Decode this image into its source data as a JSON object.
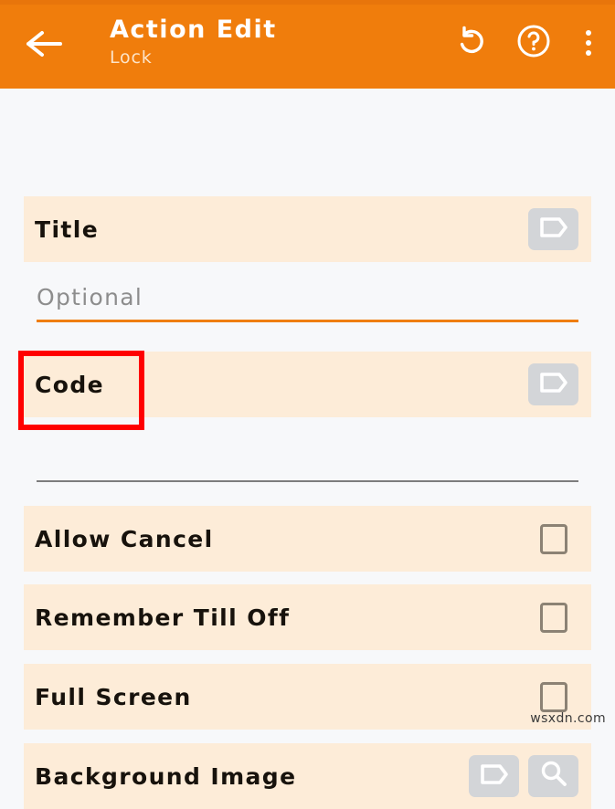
{
  "appbar": {
    "back_icon": "arrow-left-icon",
    "title": "Action Edit",
    "subtitle": "Lock",
    "actions": [
      {
        "name": "undo-icon",
        "label": "Undo"
      },
      {
        "name": "help-icon",
        "label": "Help"
      },
      {
        "name": "overflow-menu-icon",
        "label": "More options"
      }
    ],
    "background_color": "#f07d0c",
    "title_color": "#ffffff",
    "subtitle_color": "#fde4c8"
  },
  "form": {
    "rows": [
      {
        "label": "Title",
        "type": "text-with-tag",
        "buttons": [
          "tag-icon"
        ]
      },
      {
        "label": "Code",
        "type": "text-with-tag",
        "buttons": [
          "tag-icon"
        ],
        "highlighted": true
      },
      {
        "label": "Allow Cancel",
        "type": "checkbox",
        "checked": false
      },
      {
        "label": "Remember Till Off",
        "type": "checkbox",
        "checked": false
      },
      {
        "label": "Full Screen",
        "type": "checkbox",
        "checked": false
      },
      {
        "label": "Background Image",
        "type": "buttons",
        "buttons": [
          "tag-icon",
          "search-icon"
        ]
      }
    ],
    "title_field": {
      "value": "",
      "placeholder": "Optional",
      "focused": true,
      "underline_color": "#ef7e10"
    },
    "code_field": {
      "value": "",
      "placeholder": "",
      "focused": false,
      "underline_color": "#7d7d7d"
    },
    "row_background": "#fdecd8",
    "label_color": "#17120c"
  },
  "annotation": {
    "target": "Code",
    "color": "#ff0000"
  },
  "watermark": {
    "text": "wsxdn.com"
  }
}
